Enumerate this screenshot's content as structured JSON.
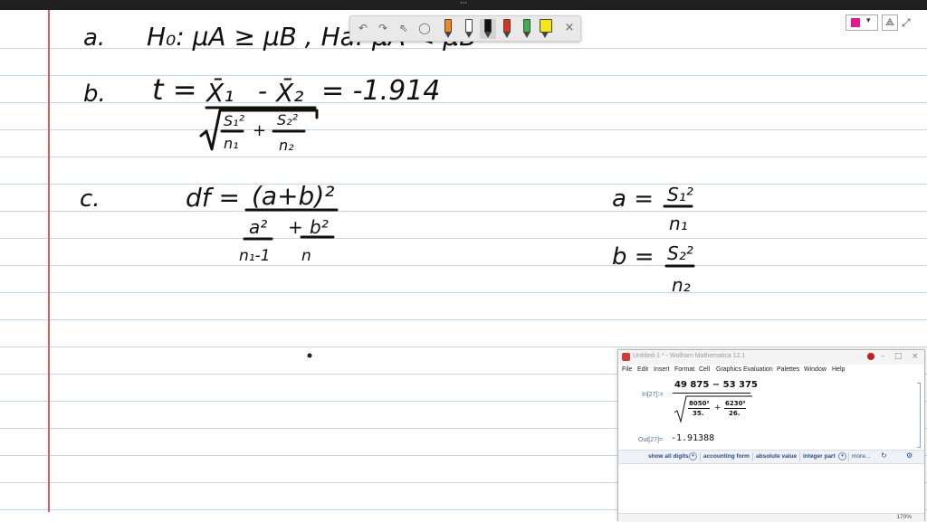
{
  "topbar": {
    "dots": "···"
  },
  "colors": {
    "margin_line": "#e05a5a",
    "rule_line": "#c4d7ea",
    "ink": "#111111",
    "selected_pen_color": "#e4198f"
  },
  "pen_toolbar": {
    "buttons": [
      "undo-icon",
      "redo-icon",
      "select-icon",
      "lasso-icon"
    ],
    "pens": [
      {
        "name": "pen-orange",
        "color": "#f08a1c"
      },
      {
        "name": "pen-white",
        "color": "#ffffff"
      },
      {
        "name": "pen-black",
        "color": "#111111",
        "selected": true
      },
      {
        "name": "pen-red",
        "color": "#e0301e"
      },
      {
        "name": "pen-green",
        "color": "#3cb34a"
      },
      {
        "name": "highlighter-yellow",
        "color": "#f5e61a"
      }
    ],
    "close_glyph": "×"
  },
  "top_right": {
    "chevron": "▾",
    "settings_glyph": "⟁",
    "expand_glyph": "⤢"
  },
  "notes": {
    "a_label": "a.",
    "a_expr": "H₀: μA ≥ μB  ,  Ha: μA < μB",
    "b_label": "b.",
    "b_t": "t =",
    "b_result": "= -1.914",
    "c_label": "c.",
    "c_df": "df =",
    "c_numerator": "(a+b)²",
    "c_a_def": "a =",
    "c_b_def": "b =",
    "s1sq": "S₁²",
    "n1": "n₁",
    "s2sq": "S₂²",
    "n2": "n₂",
    "a2": "a²",
    "b2": "b²",
    "n1minus1": "n₁-1",
    "n": "n",
    "xbar1": "X̄₁",
    "minus": "-",
    "xbar2": "X̄₂",
    "plus": "+"
  },
  "mathematica": {
    "title": "Untitled-1 * - Wolfram Mathematica 12.1",
    "window_controls": [
      "–",
      "□",
      "×"
    ],
    "menu": [
      "File",
      "Edit",
      "Insert",
      "Format",
      "Cell",
      "Graphics",
      "Evaluation",
      "Palettes",
      "Window",
      "Help"
    ],
    "in_label": "In[27]:=",
    "numerator": "49 875 − 53 375",
    "term1_num": "8050²",
    "term1_den": "35.",
    "plus": "+",
    "term2_num": "6230²",
    "term2_den": "26.",
    "out_label": "Out[27]=",
    "output": "-1.91388",
    "suggestions": [
      "show all digits",
      "accounting form",
      "absolute value",
      "integer part",
      "more..."
    ],
    "zoom": "170%"
  }
}
